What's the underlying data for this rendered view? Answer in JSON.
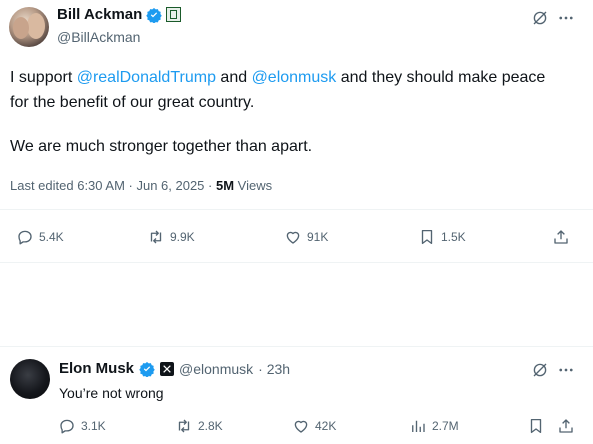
{
  "post1": {
    "author_name": "Bill Ackman",
    "author_handle": "@BillAckman",
    "text_prefix": "I support ",
    "mention1": "@realDonaldTrump",
    "text_middle": " and ",
    "mention2": "@elonmusk",
    "text_suffix": " and they should make peace for the benefit of our great country.",
    "text_para2": "We are much stronger together than apart.",
    "meta_prefix": "Last edited 6:30 AM · Jun 6, 2025 · ",
    "views_count": "5M",
    "views_label": " Views",
    "actions": {
      "replies": "5.4K",
      "reposts": "9.9K",
      "likes": "91K",
      "bookmarks": "1.5K"
    }
  },
  "post2": {
    "author_name": "Elon Musk",
    "author_handle": "@elonmusk",
    "time": "· 23h",
    "text": "You’re not wrong",
    "actions": {
      "replies": "3.1K",
      "reposts": "2.8K",
      "likes": "42K",
      "views": "2.7M"
    }
  },
  "colors": {
    "accent": "#1d9bf0",
    "muted": "#536471",
    "text": "#0f1419"
  },
  "icons": [
    "more-icon",
    "grok-icon",
    "reply-icon",
    "repost-icon",
    "like-icon",
    "bookmark-icon",
    "share-icon",
    "views-icon",
    "verified-icon",
    "x-affiliate-icon",
    "gold-badge-icon"
  ]
}
